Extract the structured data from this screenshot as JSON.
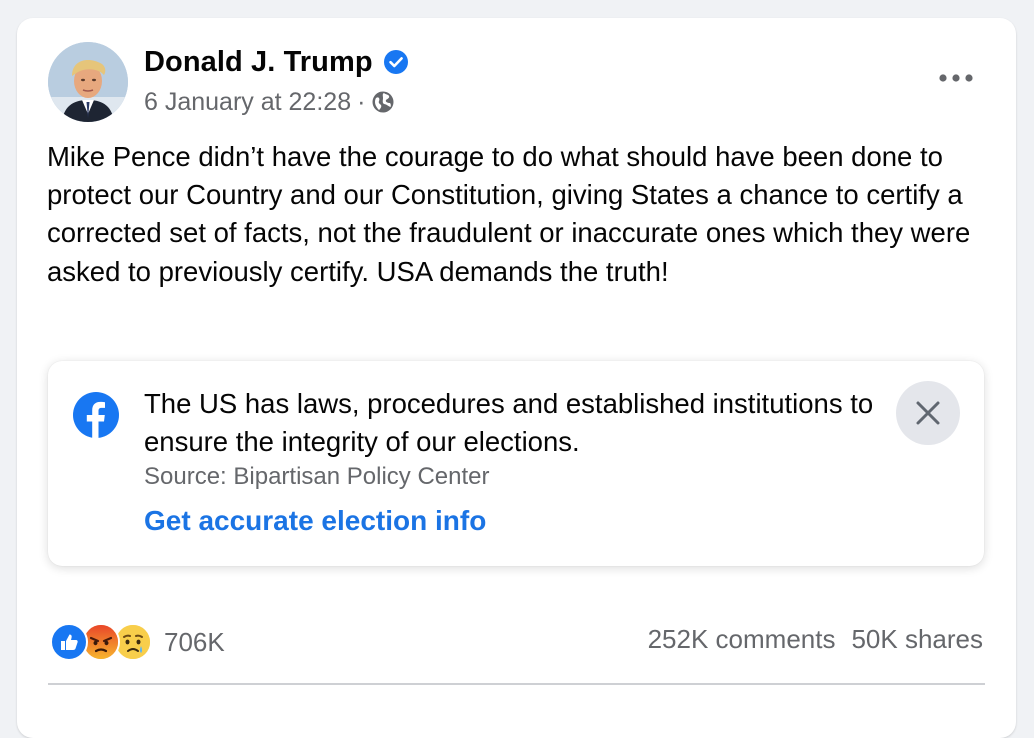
{
  "post": {
    "author": "Donald J. Trump",
    "timestamp": "6 January at 22:28",
    "separator": "·",
    "text": "Mike Pence didn’t have the courage to do what should have been done to protect our Country and our Constitution, giving States a chance to certify a corrected set of facts, not the fraudulent or inaccurate ones which they were asked to previously certify. USA demands the truth!"
  },
  "info_label": {
    "text": "The US has laws, procedures and established institutions to ensure the integrity of our elections.",
    "source": "Source: Bipartisan Policy Center",
    "link": "Get accurate election info"
  },
  "engagement": {
    "reaction_count": "706K",
    "reactions": [
      "like-icon",
      "angry-icon",
      "sad-icon"
    ],
    "comments": "252K comments",
    "shares": "50K shares"
  },
  "colors": {
    "link_blue": "#1b74e4",
    "verified_blue": "#1877f2",
    "secondary_text": "#65676b",
    "background": "#f0f2f5"
  }
}
